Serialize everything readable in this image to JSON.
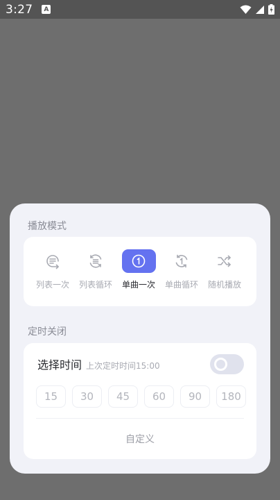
{
  "status_bar": {
    "time": "3:27",
    "notification_icon": "a-notification-icon",
    "icons": [
      "wifi-icon",
      "cellular-signal-icon",
      "battery-charging-icon"
    ]
  },
  "colors": {
    "accent": "#6472f0",
    "sheet_bg": "#f1f2f8",
    "card_bg": "#ffffff",
    "muted_text": "#a8aab2",
    "dark_text": "#2a2b30"
  },
  "playback_mode": {
    "title": "播放模式",
    "modes": [
      {
        "label": "列表一次",
        "icon": "list-once-icon",
        "active": false
      },
      {
        "label": "列表循环",
        "icon": "list-repeat-icon",
        "active": false
      },
      {
        "label": "单曲一次",
        "icon": "single-once-icon",
        "active": true
      },
      {
        "label": "单曲循环",
        "icon": "single-repeat-icon",
        "active": false
      },
      {
        "label": "随机播放",
        "icon": "shuffle-icon",
        "active": false
      }
    ],
    "selected": "单曲一次"
  },
  "sleep_timer": {
    "title": "定时关闭",
    "select_time_label": "选择时间",
    "last_timer_text": "上次定时时间15:00",
    "toggle_on": false,
    "options": [
      "15",
      "30",
      "45",
      "60",
      "90",
      "180"
    ],
    "custom_label": "自定义"
  }
}
